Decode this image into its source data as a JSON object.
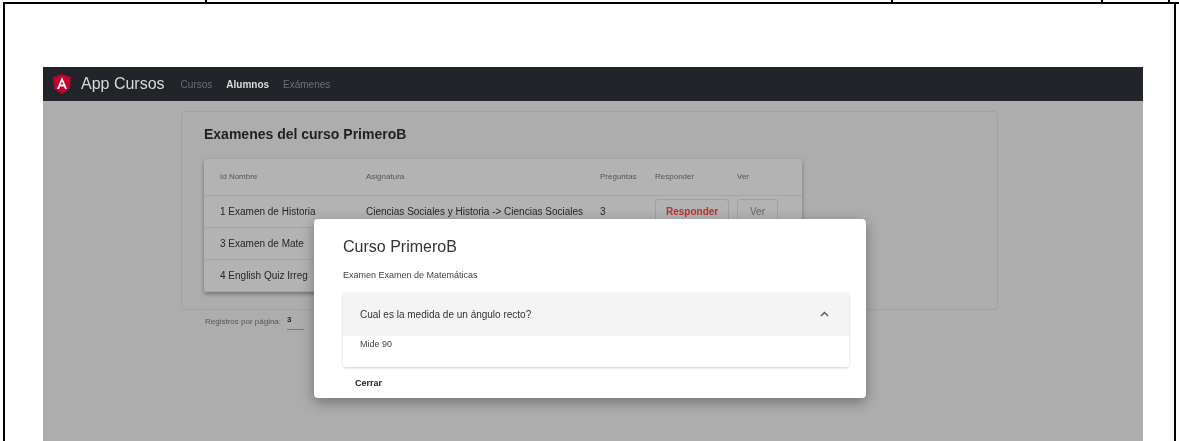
{
  "navbar": {
    "brand": "App Cursos",
    "links": [
      {
        "label": "Cursos",
        "selected": false
      },
      {
        "label": "Alumnos",
        "selected": true
      },
      {
        "label": "Exámenes",
        "selected": false
      }
    ]
  },
  "card": {
    "title": "Examenes del curso PrimeroB",
    "table": {
      "columns": [
        "Id Nombre",
        "Asignatura",
        "Preguntas",
        "Responder",
        "Ver"
      ],
      "rows": [
        {
          "name": "1 Examen de Historia",
          "subject": "Ciencias Sociales y Historia -> Ciencias Sociales",
          "questions": "3",
          "respond": {
            "label": "Responder",
            "disabled": false
          },
          "view": {
            "label": "Ver",
            "disabled": true
          }
        },
        {
          "name": "3 Examen de Mate"
        },
        {
          "name": "4 English Quiz Irreg"
        }
      ]
    },
    "paginator": {
      "label": "Registros por página:",
      "value": "3"
    }
  },
  "dialog": {
    "title": "Curso PrimeroB",
    "subtitle": "Examen Examen de Matemáticas",
    "panels": [
      {
        "question": "Cual es la medida de un ángulo recto?",
        "answer": "Mide 90",
        "expanded": true
      }
    ],
    "close": "Cerrar"
  }
}
